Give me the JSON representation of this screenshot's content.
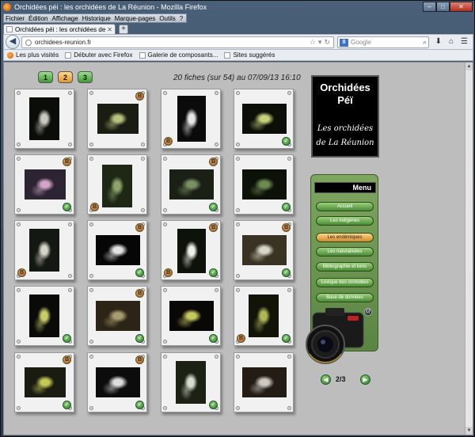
{
  "window": {
    "title": "Orchidées péi : les orchidées de La Réunion - Mozilla Firefox"
  },
  "menubar": [
    "Fichier",
    "Édition",
    "Affichage",
    "Historique",
    "Marque-pages",
    "Outils",
    "?"
  ],
  "tab": {
    "title": "Orchidées péi : les orchidées de La Réuni..."
  },
  "navbar": {
    "url": "orchidees-reunion.fr",
    "search_placeholder": "Google"
  },
  "bookmarks": [
    "Les plus visités",
    "Débuter avec Firefox",
    "Galerie de composants...",
    "Sites suggérés"
  ],
  "page": {
    "page_buttons": [
      "1",
      "2",
      "3"
    ],
    "active_page_button": "2",
    "heading": "20 fiches (sur 54) au 07/09/13 16:10",
    "logo": {
      "line1": "Orchidées",
      "line2": "Péï",
      "line3": "Les orchidées",
      "line4": "de La Réunion"
    },
    "menu": {
      "title": "Menu",
      "items": [
        "Accueil",
        "Les indigènes",
        "Les endémiques",
        "Les naturalisées",
        "Bibliographie et liens",
        "Lexique des orchidées",
        "Base de données"
      ],
      "active_item": "Les endémiques",
      "contact_icon": "@"
    },
    "pager": {
      "current": "2/3"
    },
    "badge_marks": {
      "book": "B",
      "check": "✓"
    },
    "thumbnails": [
      {
        "badges": [],
        "photo": "spiky white orchid",
        "colors": [
          "#0a0d08",
          "#c9c9c0"
        ]
      },
      {
        "badges": [
          "book-tr"
        ],
        "photo": "green orchid",
        "colors": [
          "#1a1d12",
          "#b9c27a"
        ]
      },
      {
        "badges": [
          "book-bl"
        ],
        "photo": "white orchid",
        "colors": [
          "#0b0b0b",
          "#e6e6e6"
        ]
      },
      {
        "badges": [
          "check-br"
        ],
        "photo": "green lip orchid",
        "colors": [
          "#0c0f08",
          "#c8d07a"
        ]
      },
      {
        "badges": [
          "book-tr",
          "check-br"
        ],
        "photo": "pink orchid",
        "colors": [
          "#2c2432",
          "#d2a4c8"
        ]
      },
      {
        "badges": [
          "book-bl"
        ],
        "photo": "leafy orchid",
        "colors": [
          "#1e2815",
          "#8aa46a"
        ]
      },
      {
        "badges": [
          "book-tr",
          "check-br"
        ],
        "photo": "small green orchid",
        "colors": [
          "#1a2015",
          "#7a8f63"
        ]
      },
      {
        "badges": [
          "check-br"
        ],
        "photo": "dark green orchid",
        "colors": [
          "#0c1208",
          "#6e8a52"
        ]
      },
      {
        "badges": [
          "book-bl"
        ],
        "photo": "white star orchid",
        "colors": [
          "#141812",
          "#d4d4c8"
        ]
      },
      {
        "badges": [
          "book-tr",
          "check-br"
        ],
        "photo": "white spider orchid",
        "colors": [
          "#060606",
          "#e2e2e2"
        ]
      },
      {
        "badges": [
          "book-tr",
          "book-bl",
          "check-br"
        ],
        "photo": "white orchid",
        "colors": [
          "#0d120a",
          "#eeeeea"
        ]
      },
      {
        "badges": [
          "book-tr",
          "check-br"
        ],
        "photo": "white cluster orchid",
        "colors": [
          "#3a3324",
          "#d8d8c8"
        ]
      },
      {
        "badges": [
          "check-br"
        ],
        "photo": "yellow orchid",
        "colors": [
          "#0a0a08",
          "#c8cc66"
        ]
      },
      {
        "badges": [
          "book-tr",
          "check-br"
        ],
        "photo": "brown orchid",
        "colors": [
          "#2c2416",
          "#a89c70"
        ]
      },
      {
        "badges": [
          "check-br"
        ],
        "photo": "yellow-green orchid",
        "colors": [
          "#0a0806",
          "#c6c85e"
        ]
      },
      {
        "badges": [
          "book-bl",
          "check-br"
        ],
        "photo": "green flowers",
        "colors": [
          "#121408",
          "#b0b658"
        ]
      },
      {
        "badges": [
          "book-tr",
          "check-br"
        ],
        "photo": "yellow orchid",
        "colors": [
          "#1a1c12",
          "#c6c856"
        ]
      },
      {
        "badges": [
          "book-tr",
          "check-br"
        ],
        "photo": "white orchid",
        "colors": [
          "#0c0c0c",
          "#dcdcdc"
        ]
      },
      {
        "badges": [
          "check-br"
        ],
        "photo": "white orchid",
        "colors": [
          "#1b2214",
          "#d4dccc"
        ]
      },
      {
        "badges": [],
        "photo": "white spiky orchid",
        "colors": [
          "#221c14",
          "#ccc8c2"
        ]
      }
    ]
  }
}
